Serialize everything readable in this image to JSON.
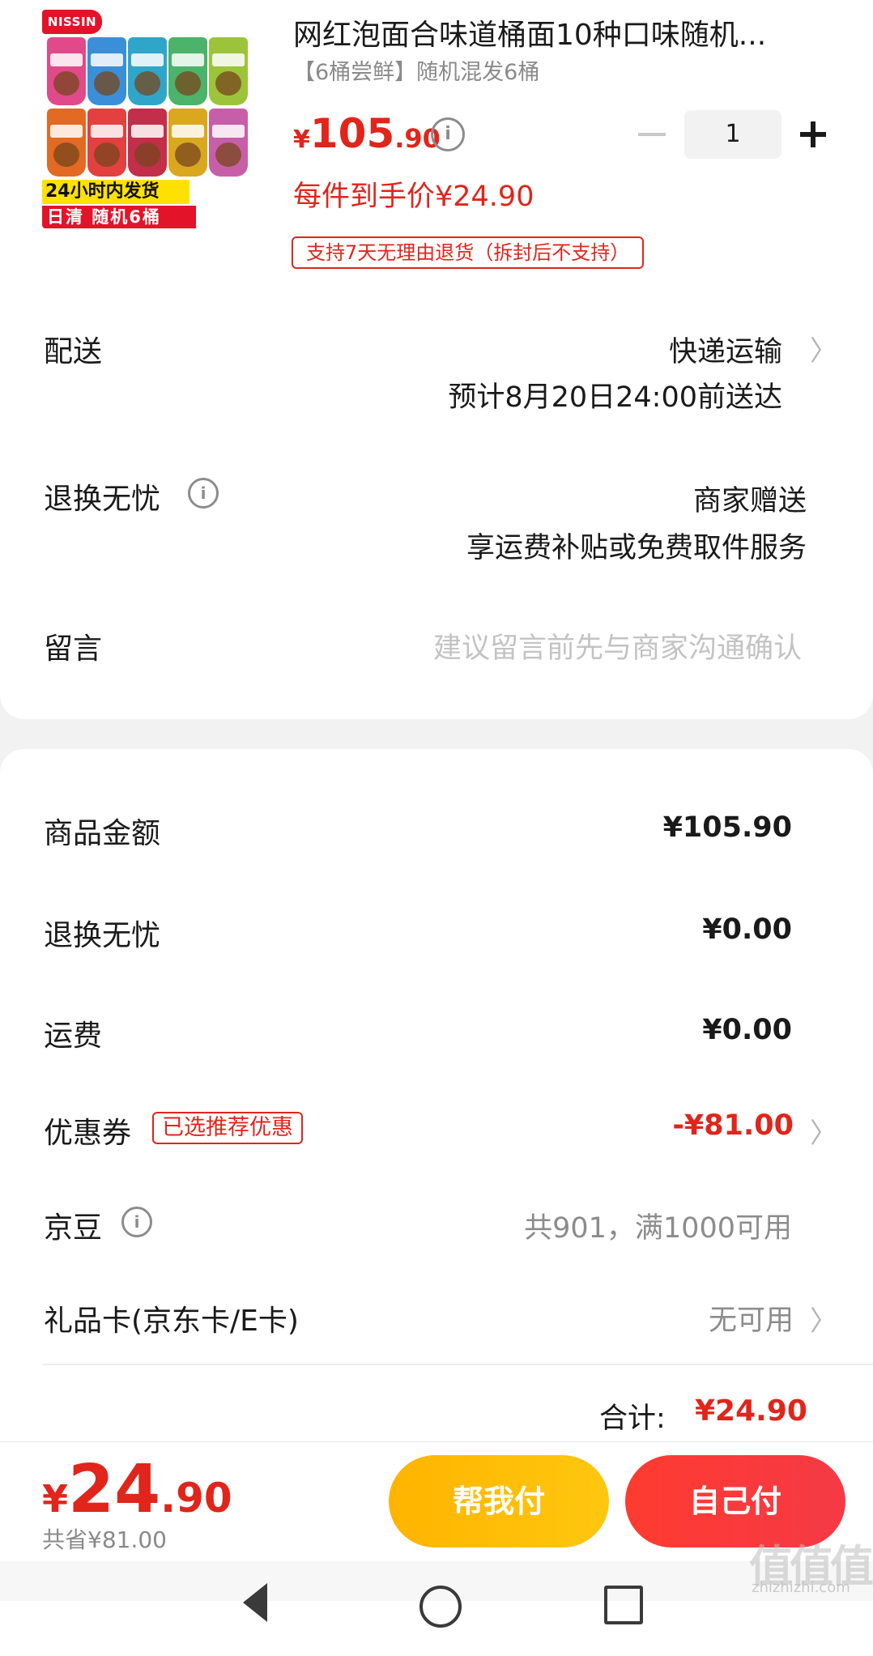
{
  "product": {
    "image": {
      "brand": "NISSIN",
      "banner_top": "24小时内发货",
      "banner_bottom": "日清 随机6桶"
    },
    "title": "网红泡面合味道桶面10种口味随机...",
    "subtitle": "【6桶尝鲜】随机混发6桶",
    "price": {
      "symbol": "¥",
      "integer": "105",
      "decimal": ".90"
    },
    "quantity": "1",
    "unit_price_text": "每件到手价¥24.90",
    "return_policy_tag": "支持7天无理由退货（拆封后不支持）"
  },
  "delivery": {
    "label": "配送",
    "method": "快递运输",
    "eta": "预计8月20日24:00前送达"
  },
  "worry_free": {
    "label": "退换无忧",
    "line1": "商家赠送",
    "line2": "享运费补贴或免费取件服务"
  },
  "message": {
    "label": "留言",
    "placeholder": "建议留言前先与商家沟通确认"
  },
  "summary": {
    "goods_amount": {
      "label": "商品金额",
      "value": "¥105.90"
    },
    "worry_free": {
      "label": "退换无忧",
      "value": "¥0.00"
    },
    "shipping": {
      "label": "运费",
      "value": "¥0.00"
    },
    "coupon": {
      "label": "优惠券",
      "tag": "已选推荐优惠",
      "value": "-¥81.00"
    },
    "jd_beans": {
      "label": "京豆",
      "value": "共901，满1000可用"
    },
    "gift_card": {
      "label": "礼品卡(京东卡/E卡)",
      "value": "无可用"
    },
    "total": {
      "label": "合计:",
      "value": "¥24.90"
    }
  },
  "footer": {
    "pay_price": {
      "symbol": "¥",
      "integer": "24",
      "decimal": ".90"
    },
    "saved": "共省¥81.00",
    "help_pay": "帮我付",
    "self_pay": "自己付"
  },
  "watermark": {
    "main": "值值值",
    "sub": "zhizhizhi.com"
  },
  "icons": {
    "info": "info-circle-icon",
    "chevron": "chevron-right-icon",
    "minus": "minus-icon",
    "plus": "plus-icon"
  },
  "colors": {
    "accent_red": "#e1251b",
    "help_pay_yellow": "#ffb400",
    "self_pay_red": "#ff3b30"
  }
}
